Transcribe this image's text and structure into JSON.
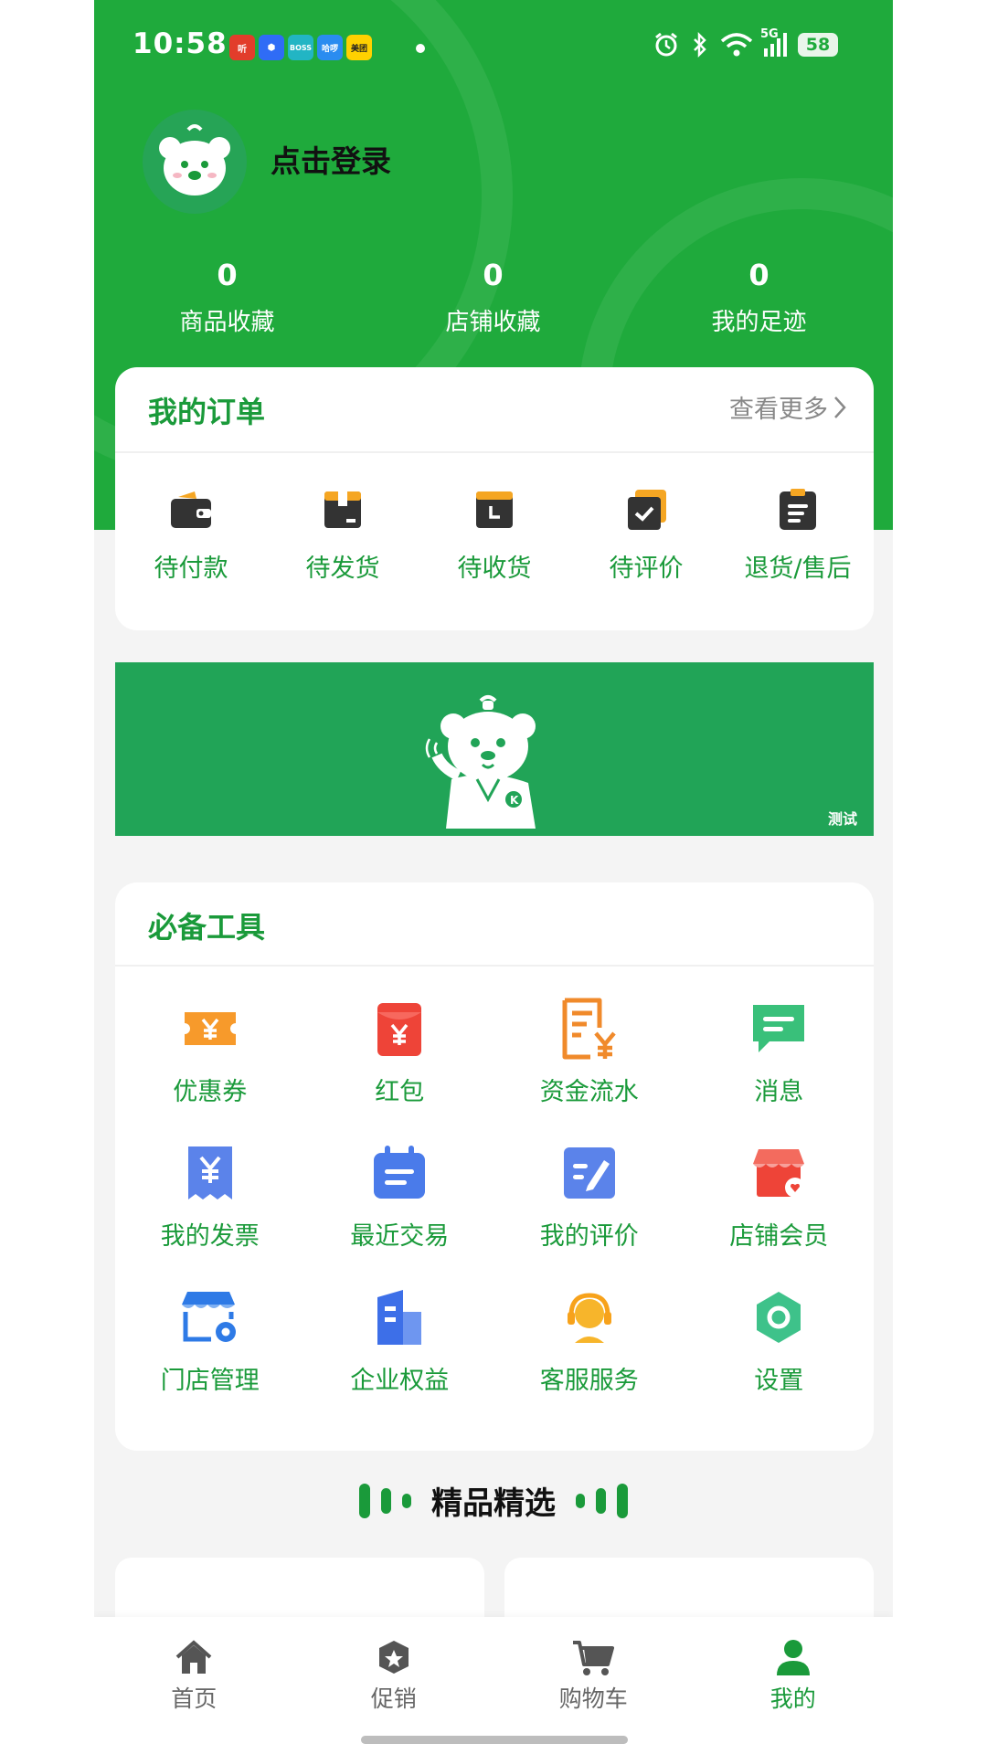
{
  "colors": {
    "brand_green": "#1faa3c",
    "label_green": "#1a9a3a",
    "page_bg": "#f4f4f4"
  },
  "status_bar": {
    "time": "10:58",
    "app_icons": [
      {
        "name": "ting-app-icon",
        "text": "听",
        "color": "#e23d2b"
      },
      {
        "name": "baidu-netdisk-icon",
        "text": "⬢",
        "color": "#2f6cf6"
      },
      {
        "name": "boss-zhipin-icon",
        "text": "BOSS",
        "color": "#22b5c4"
      },
      {
        "name": "haluo-icon",
        "text": "哈啰",
        "color": "#2a8cf0"
      },
      {
        "name": "meituan-icon",
        "text": "美团",
        "color": "#ffd100"
      }
    ],
    "network": "5G",
    "battery": "58"
  },
  "profile": {
    "login_text": "点击登录"
  },
  "stats": [
    {
      "value": "0",
      "label": "商品收藏"
    },
    {
      "value": "0",
      "label": "店铺收藏"
    },
    {
      "value": "0",
      "label": "我的足迹"
    }
  ],
  "orders": {
    "title": "我的订单",
    "more": "查看更多",
    "items": [
      {
        "label": "待付款",
        "icon": "wallet-icon"
      },
      {
        "label": "待发货",
        "icon": "box-icon"
      },
      {
        "label": "待收货",
        "icon": "clock-box-icon"
      },
      {
        "label": "待评价",
        "icon": "check-note-icon"
      },
      {
        "label": "退货/售后",
        "icon": "clipboard-icon"
      }
    ]
  },
  "banner": {
    "tag": "测试"
  },
  "tools": {
    "title": "必备工具",
    "items": [
      {
        "label": "优惠券",
        "icon": "coupon-icon"
      },
      {
        "label": "红包",
        "icon": "red-envelope-icon"
      },
      {
        "label": "资金流水",
        "icon": "bill-icon"
      },
      {
        "label": "消息",
        "icon": "message-icon"
      },
      {
        "label": "我的发票",
        "icon": "invoice-icon"
      },
      {
        "label": "最近交易",
        "icon": "calendar-list-icon"
      },
      {
        "label": "我的评价",
        "icon": "edit-icon"
      },
      {
        "label": "店铺会员",
        "icon": "store-member-icon"
      },
      {
        "label": "门店管理",
        "icon": "store-settings-icon"
      },
      {
        "label": "企业权益",
        "icon": "building-icon"
      },
      {
        "label": "客服服务",
        "icon": "headset-icon"
      },
      {
        "label": "设置",
        "icon": "settings-hex-icon"
      }
    ]
  },
  "featured": {
    "title": "精品精选"
  },
  "tabbar": [
    {
      "label": "首页",
      "icon": "home-icon",
      "active": false
    },
    {
      "label": "促销",
      "icon": "promotion-icon",
      "active": false
    },
    {
      "label": "购物车",
      "icon": "cart-icon",
      "active": false
    },
    {
      "label": "我的",
      "icon": "user-icon",
      "active": true
    }
  ]
}
